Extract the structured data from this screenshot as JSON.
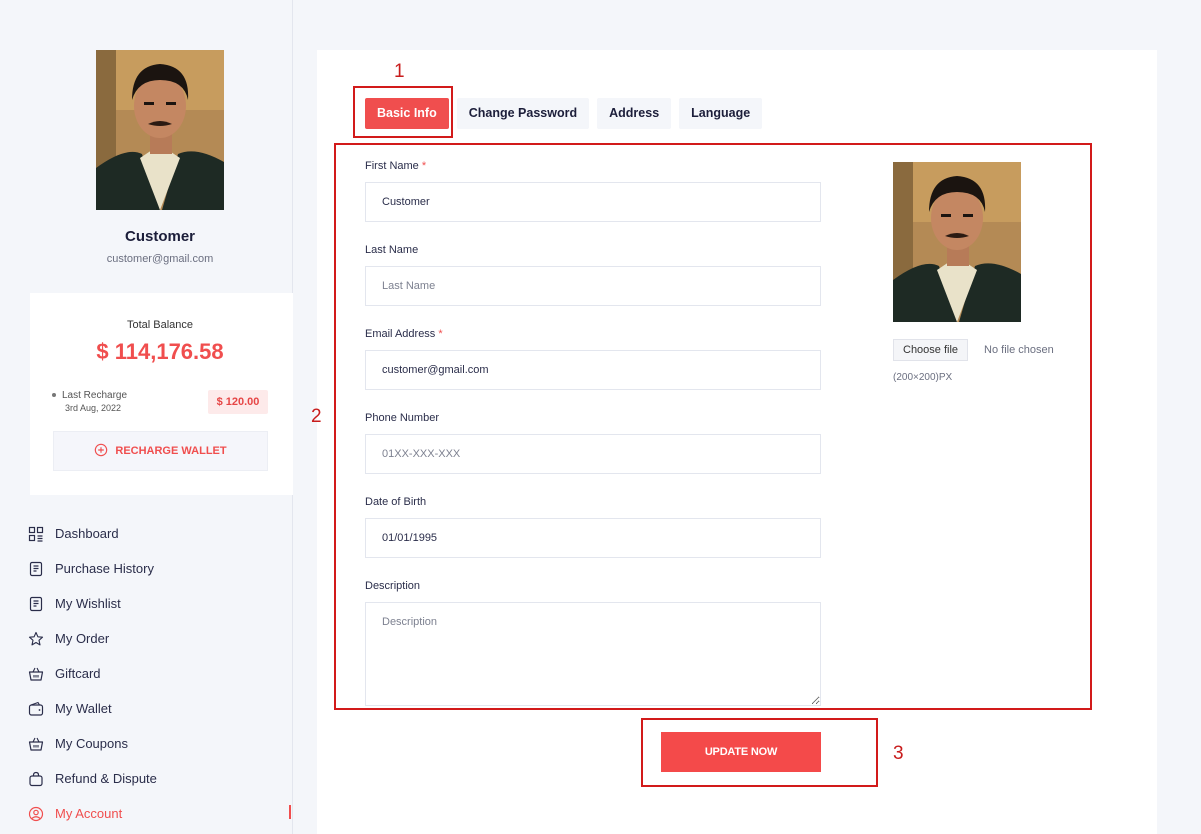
{
  "profile": {
    "name": "Customer",
    "email": "customer@gmail.com"
  },
  "wallet": {
    "total_label": "Total Balance",
    "total_value": "$ 114,176.58",
    "last_recharge_label": "Last Recharge",
    "last_recharge_date": "3rd Aug, 2022",
    "last_recharge_amount": "$ 120.00",
    "recharge_button": "RECHARGE WALLET"
  },
  "nav": {
    "items": [
      {
        "label": "Dashboard",
        "icon": "dashboard-icon"
      },
      {
        "label": "Purchase History",
        "icon": "receipt-icon"
      },
      {
        "label": "My Wishlist",
        "icon": "receipt-icon"
      },
      {
        "label": "My Order",
        "icon": "star-icon"
      },
      {
        "label": "Giftcard",
        "icon": "basket-icon"
      },
      {
        "label": "My Wallet",
        "icon": "wallet-icon"
      },
      {
        "label": "My Coupons",
        "icon": "basket-icon"
      },
      {
        "label": "Refund & Dispute",
        "icon": "bag-icon"
      },
      {
        "label": "My Account",
        "icon": "user-circle-icon"
      }
    ],
    "active": "My Account"
  },
  "tabs": [
    {
      "label": "Basic Info",
      "active": true
    },
    {
      "label": "Change Password",
      "active": false
    },
    {
      "label": "Address",
      "active": false
    },
    {
      "label": "Language",
      "active": false
    }
  ],
  "form": {
    "first_name": {
      "label": "First Name",
      "required_mark": "*",
      "value": "Customer",
      "placeholder": ""
    },
    "last_name": {
      "label": "Last Name",
      "value": "",
      "placeholder": "Last Name"
    },
    "email": {
      "label": "Email Address",
      "required_mark": "*",
      "value": "customer@gmail.com",
      "placeholder": ""
    },
    "phone": {
      "label": "Phone Number",
      "value": "",
      "placeholder": "01XX-XXX-XXX"
    },
    "dob": {
      "label": "Date of Birth",
      "value": "01/01/1995",
      "placeholder": ""
    },
    "description": {
      "label": "Description",
      "value": "",
      "placeholder": "Description"
    },
    "update_button": "UPDATE NOW"
  },
  "photo_upload": {
    "choose_button": "Choose file",
    "file_status": "No file chosen",
    "size_note": "(200×200)PX"
  },
  "annotations": {
    "n1": "1",
    "n2": "2",
    "n3": "3"
  },
  "colors": {
    "accent": "#f04e4e",
    "annotation": "#d21a1a",
    "page_bg": "#f4f6fa"
  }
}
